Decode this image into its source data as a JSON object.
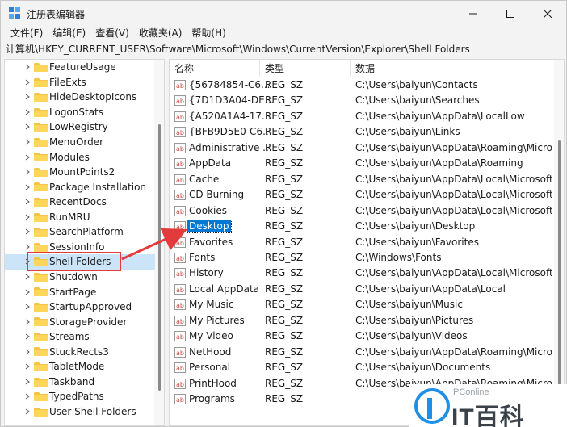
{
  "window": {
    "title": "注册表编辑器",
    "icon": "registry-editor-icon"
  },
  "menu": [
    "文件(F)",
    "编辑(E)",
    "查看(V)",
    "收藏夹(A)",
    "帮助(H)"
  ],
  "address": "计算机\\HKEY_CURRENT_USER\\Software\\Microsoft\\Windows\\CurrentVersion\\Explorer\\Shell Folders",
  "tree": {
    "items": [
      "FeatureUsage",
      "FileExts",
      "HideDesktopIcons",
      "LogonStats",
      "LowRegistry",
      "MenuOrder",
      "Modules",
      "MountPoints2",
      "Package Installation",
      "RecentDocs",
      "RunMRU",
      "SearchPlatform",
      "SessionInfo",
      "Shell Folders",
      "Shutdown",
      "StartPage",
      "StartupApproved",
      "StorageProvider",
      "Streams",
      "StuckRects3",
      "TabletMode",
      "Taskband",
      "TypedPaths",
      "User Shell Folders"
    ],
    "selected": "Shell Folders"
  },
  "columns": {
    "name": "名称",
    "type": "类型",
    "data": "数据"
  },
  "values": [
    {
      "name": "{56784854-C6...",
      "type": "REG_SZ",
      "data": "C:\\Users\\baiyun\\Contacts"
    },
    {
      "name": "{7D1D3A04-DE...",
      "type": "REG_SZ",
      "data": "C:\\Users\\baiyun\\Searches"
    },
    {
      "name": "{A520A1A4-17...",
      "type": "REG_SZ",
      "data": "C:\\Users\\baiyun\\AppData\\LocalLow"
    },
    {
      "name": "{BFB9D5E0-C6...",
      "type": "REG_SZ",
      "data": "C:\\Users\\baiyun\\Links"
    },
    {
      "name": "Administrative ...",
      "type": "REG_SZ",
      "data": "C:\\Users\\baiyun\\AppData\\Roaming\\Microsof"
    },
    {
      "name": "AppData",
      "type": "REG_SZ",
      "data": "C:\\Users\\baiyun\\AppData\\Roaming"
    },
    {
      "name": "Cache",
      "type": "REG_SZ",
      "data": "C:\\Users\\baiyun\\AppData\\Local\\Microsoft\\W"
    },
    {
      "name": "CD Burning",
      "type": "REG_SZ",
      "data": "C:\\Users\\baiyun\\AppData\\Local\\Microsoft\\W"
    },
    {
      "name": "Cookies",
      "type": "REG_SZ",
      "data": "C:\\Users\\baiyun\\AppData\\Local\\Microsoft\\W"
    },
    {
      "name": "Desktop",
      "type": "REG_SZ",
      "data": "C:\\Users\\baiyun\\Desktop"
    },
    {
      "name": "Favorites",
      "type": "REG_SZ",
      "data": "C:\\Users\\baiyun\\Favorites"
    },
    {
      "name": "Fonts",
      "type": "REG_SZ",
      "data": "C:\\Windows\\Fonts"
    },
    {
      "name": "History",
      "type": "REG_SZ",
      "data": "C:\\Users\\baiyun\\AppData\\Local\\Microsoft\\W"
    },
    {
      "name": "Local AppData",
      "type": "REG_SZ",
      "data": "C:\\Users\\baiyun\\AppData\\Local"
    },
    {
      "name": "My Music",
      "type": "REG_SZ",
      "data": "C:\\Users\\baiyun\\Music"
    },
    {
      "name": "My Pictures",
      "type": "REG_SZ",
      "data": "C:\\Users\\baiyun\\Pictures"
    },
    {
      "name": "My Video",
      "type": "REG_SZ",
      "data": "C:\\Users\\baiyun\\Videos"
    },
    {
      "name": "NetHood",
      "type": "REG_SZ",
      "data": "C:\\Users\\baiyun\\AppData\\Roaming\\Microsof"
    },
    {
      "name": "Personal",
      "type": "REG_SZ",
      "data": "C:\\Users\\baiyun\\Documents"
    },
    {
      "name": "PrintHood",
      "type": "REG_SZ",
      "data": "C:\\Users\\baiyun\\AppData\\Roaming\\Microsof"
    },
    {
      "name": "Programs",
      "type": "REG_SZ",
      "data": ""
    }
  ],
  "selected_value": "Desktop",
  "annotation": {
    "color": "#e33b3b"
  },
  "watermark": {
    "small": "PConline",
    "big": "IT百科"
  },
  "colors": {
    "selection": "#0078d4",
    "folder": "#f6c445",
    "reg_icon": "#d0463b"
  }
}
